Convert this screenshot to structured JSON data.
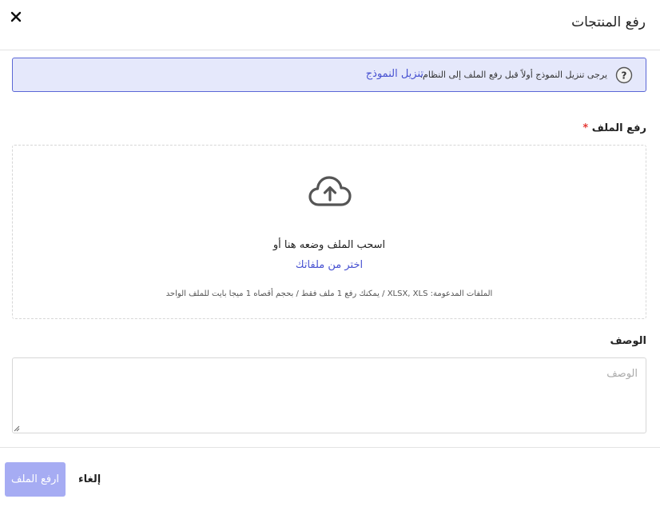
{
  "dialog": {
    "title": "رفع المنتجات"
  },
  "banner": {
    "message": "يرجى تنزيل النموذج أولاً قبل رفع الملف إلى النظام.",
    "link_text": "تنزيل النموذج",
    "icon": "question-circle-icon"
  },
  "upload": {
    "label": "رفع الملف",
    "required_mark": "*",
    "drag_text": "اسحب الملف وضعه هنا أو",
    "browse_link": "اختر من ملفاتك",
    "hint": "الملفات المدعومة: XLSX, XLS / يمكنك رفع 1 ملف فقط / بحجم أقصاه 1 ميجا بايت للملف الواحد",
    "icon": "cloud-upload-icon"
  },
  "description": {
    "label": "الوصف",
    "placeholder": "الوصف",
    "value": ""
  },
  "footer": {
    "upload_button": "ارفع الملف",
    "cancel_button": "إلغاء"
  },
  "colors": {
    "accent": "#4751d1",
    "banner_bg": "#e5e8fb",
    "banner_border": "#5b67d6",
    "upload_button_disabled": "#a6acf3",
    "required": "#e53935"
  }
}
